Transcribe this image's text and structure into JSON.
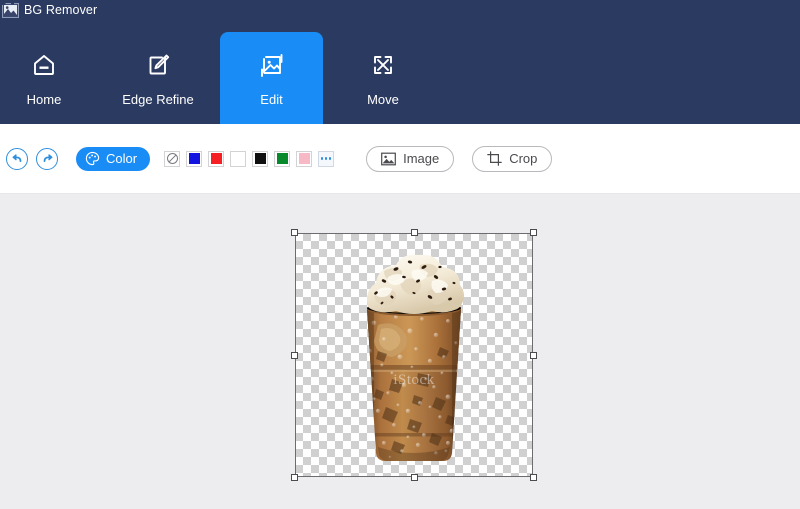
{
  "window": {
    "title": "BG Remover",
    "logo_icon": "app-logo-icon"
  },
  "nav": {
    "tabs": [
      {
        "label": "Home",
        "icon": "home-icon",
        "active": false
      },
      {
        "label": "Edge Refine",
        "icon": "pen-square-icon",
        "active": false
      },
      {
        "label": "Edit",
        "icon": "image-edit-icon",
        "active": true
      },
      {
        "label": "Move",
        "icon": "move-expand-icon",
        "active": false
      }
    ],
    "active_tab": "Edit"
  },
  "toolbar": {
    "undo": {
      "label": "Undo",
      "icon": "undo-arrow-icon"
    },
    "redo": {
      "label": "Redo",
      "icon": "redo-arrow-icon"
    },
    "color_button": {
      "label": "Color",
      "icon": "palette-icon"
    },
    "swatches": [
      {
        "name": "transparent",
        "color": "none",
        "label": "Transparent"
      },
      {
        "name": "blue",
        "color": "#1414e0",
        "label": "Blue"
      },
      {
        "name": "red",
        "color": "#f61f24",
        "label": "Red"
      },
      {
        "name": "white",
        "color": "#ffffff",
        "label": "White"
      },
      {
        "name": "black",
        "color": "#101010",
        "label": "Black"
      },
      {
        "name": "green",
        "color": "#07892c",
        "label": "Green"
      },
      {
        "name": "pink",
        "color": "#f7b9c6",
        "label": "Pink"
      },
      {
        "name": "more",
        "color": "none",
        "label": "More colors"
      }
    ],
    "image_button": {
      "label": "Image",
      "icon": "picture-icon"
    },
    "crop_button": {
      "label": "Crop",
      "icon": "crop-icon"
    }
  },
  "canvas": {
    "background": "#ededef",
    "selection": {
      "transparency_pattern": "checkerboard",
      "handles": [
        "top-left",
        "top-center",
        "top-right",
        "middle-left",
        "middle-right",
        "bottom-left",
        "bottom-center",
        "bottom-right"
      ]
    },
    "subject": {
      "name": "iced-coffee-cup",
      "watermark": "iStock"
    }
  },
  "colors": {
    "navbar_bg": "#2b3a61",
    "accent": "#1a8cf5",
    "toolbar_bg": "#ffffff",
    "canvas_bg": "#ededef"
  }
}
